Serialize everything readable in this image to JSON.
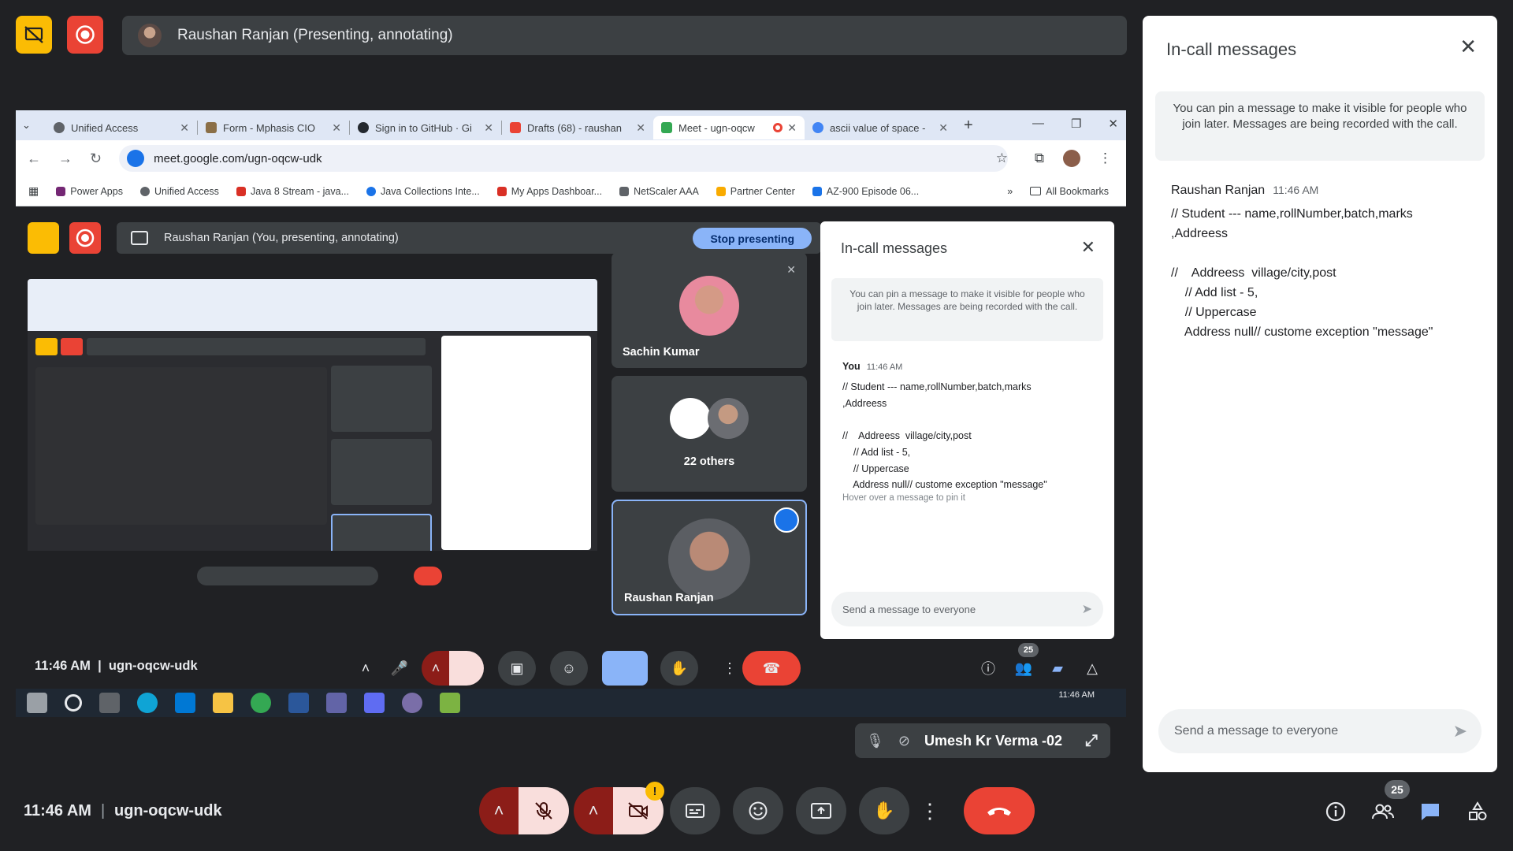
{
  "presenter_bar": {
    "name": "Raushan Ranjan (Presenting, annotating)"
  },
  "browser": {
    "tabs": [
      {
        "label": "Unified Access",
        "color": "#5f6368"
      },
      {
        "label": "Form - Mphasis CIO",
        "color": "#8b6f47"
      },
      {
        "label": "Sign in to GitHub · Gi",
        "color": "#24292f"
      },
      {
        "label": "Drafts (68) - raushan",
        "color": "#ea4335"
      },
      {
        "label": "Meet - ugn-oqcw",
        "color": "#34a853"
      },
      {
        "label": "ascii value of space -",
        "color": "#4285f4"
      }
    ],
    "url": "meet.google.com/ugn-oqcw-udk",
    "bookmarks": [
      {
        "label": "Power Apps",
        "color": "#742774"
      },
      {
        "label": "Unified Access",
        "color": "#5f6368"
      },
      {
        "label": "Java 8 Stream - java...",
        "color": "#d93025"
      },
      {
        "label": "Java Collections Inte...",
        "color": "#1a73e8"
      },
      {
        "label": "My Apps Dashboar...",
        "color": "#d93025"
      },
      {
        "label": "NetScaler AAA",
        "color": "#5f6368"
      },
      {
        "label": "Partner Center",
        "color": "#f9ab00"
      },
      {
        "label": "AZ-900 Episode 06...",
        "color": "#1a73e8"
      }
    ],
    "all_bookmarks": "All Bookmarks"
  },
  "inner_meet": {
    "bar_text": "Raushan Ranjan (You, presenting, annotating)",
    "stop_presenting": "Stop presenting",
    "tiles": [
      {
        "name": "Sachin Kumar"
      },
      {
        "name": "22 others"
      },
      {
        "name": "Raushan Ranjan"
      }
    ],
    "chat": {
      "title": "In-call messages",
      "note": "You can pin a message to make it visible for people who join later. Messages are being recorded with the call.",
      "sender": "You",
      "time": "11:46 AM",
      "message": "// Student --- name,rollNumber,batch,marks\n,Addreess\n\n//    Addreess  village/city,post\n    // Add list - 5,\n    // Uppercase\n    Address null// custome exception \"message\"",
      "hover_hint": "Hover over a message to pin it",
      "input_placeholder": "Send a message to everyone"
    },
    "time": "11:46 AM",
    "code": "ugn-oqcw-udk",
    "participant_count": "25",
    "taskbar_time": "11:46 AM"
  },
  "pinned_participant": {
    "name": "Umesh Kr Verma -02"
  },
  "chat_panel": {
    "title": "In-call messages",
    "pin_note": "You can pin a message to make it visible for people who join later. Messages are being recorded with the call.",
    "sender": "Raushan Ranjan",
    "time": "11:46 AM",
    "message": "// Student --- name,rollNumber,batch,marks\n,Addreess\n\n//    Addreess  village/city,post\n    // Add list - 5,\n    // Uppercase\n    Address null// custome exception \"message\"",
    "input_placeholder": "Send a message to everyone"
  },
  "bottom_bar": {
    "time": "11:46 AM",
    "separator": "|",
    "meeting_code": "ugn-oqcw-udk",
    "participant_count": "25",
    "warning_mark": "!"
  }
}
